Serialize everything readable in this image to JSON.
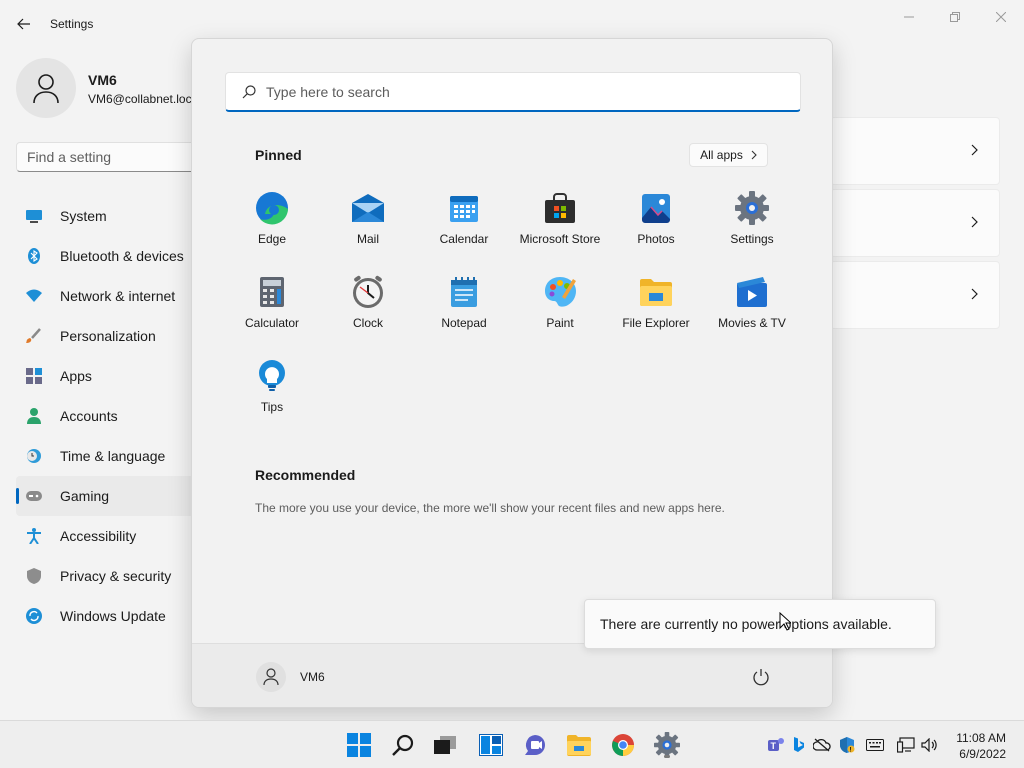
{
  "window": {
    "title": "Settings"
  },
  "profile": {
    "name": "VM6",
    "email": "VM6@collabnet.loc"
  },
  "search_setting": {
    "placeholder": "Find a setting"
  },
  "nav": [
    {
      "label": "System",
      "icon": "monitor-icon"
    },
    {
      "label": "Bluetooth & devices",
      "icon": "bluetooth-icon"
    },
    {
      "label": "Network & internet",
      "icon": "wifi-icon"
    },
    {
      "label": "Personalization",
      "icon": "brush-icon"
    },
    {
      "label": "Apps",
      "icon": "apps-icon"
    },
    {
      "label": "Accounts",
      "icon": "person-icon"
    },
    {
      "label": "Time & language",
      "icon": "clock-globe-icon"
    },
    {
      "label": "Gaming",
      "icon": "gamepad-icon",
      "active": true
    },
    {
      "label": "Accessibility",
      "icon": "accessibility-icon"
    },
    {
      "label": "Privacy & security",
      "icon": "shield-icon"
    },
    {
      "label": "Windows Update",
      "icon": "update-icon"
    }
  ],
  "start_menu": {
    "search_placeholder": "Type here to search",
    "pinned_title": "Pinned",
    "all_apps_label": "All apps",
    "apps": [
      {
        "label": "Edge",
        "icon": "edge-icon"
      },
      {
        "label": "Mail",
        "icon": "mail-icon"
      },
      {
        "label": "Calendar",
        "icon": "calendar-icon"
      },
      {
        "label": "Microsoft Store",
        "icon": "store-icon"
      },
      {
        "label": "Photos",
        "icon": "photos-icon"
      },
      {
        "label": "Settings",
        "icon": "gear-icon"
      },
      {
        "label": "Calculator",
        "icon": "calculator-icon"
      },
      {
        "label": "Clock",
        "icon": "clock-icon"
      },
      {
        "label": "Notepad",
        "icon": "notepad-icon"
      },
      {
        "label": "Paint",
        "icon": "paint-icon"
      },
      {
        "label": "File Explorer",
        "icon": "folder-icon"
      },
      {
        "label": "Movies & TV",
        "icon": "movies-icon"
      },
      {
        "label": "Tips",
        "icon": "lightbulb-icon"
      }
    ],
    "recommended_title": "Recommended",
    "recommended_text": "The more you use your device, the more we'll show your recent files and new apps here.",
    "user_name": "VM6",
    "power_tooltip": "There are currently no power options available."
  },
  "taskbar": {
    "time": "11:08 AM",
    "date": "6/9/2022"
  },
  "colors": {
    "accent": "#0067c0",
    "background": "#f3f3f3"
  }
}
